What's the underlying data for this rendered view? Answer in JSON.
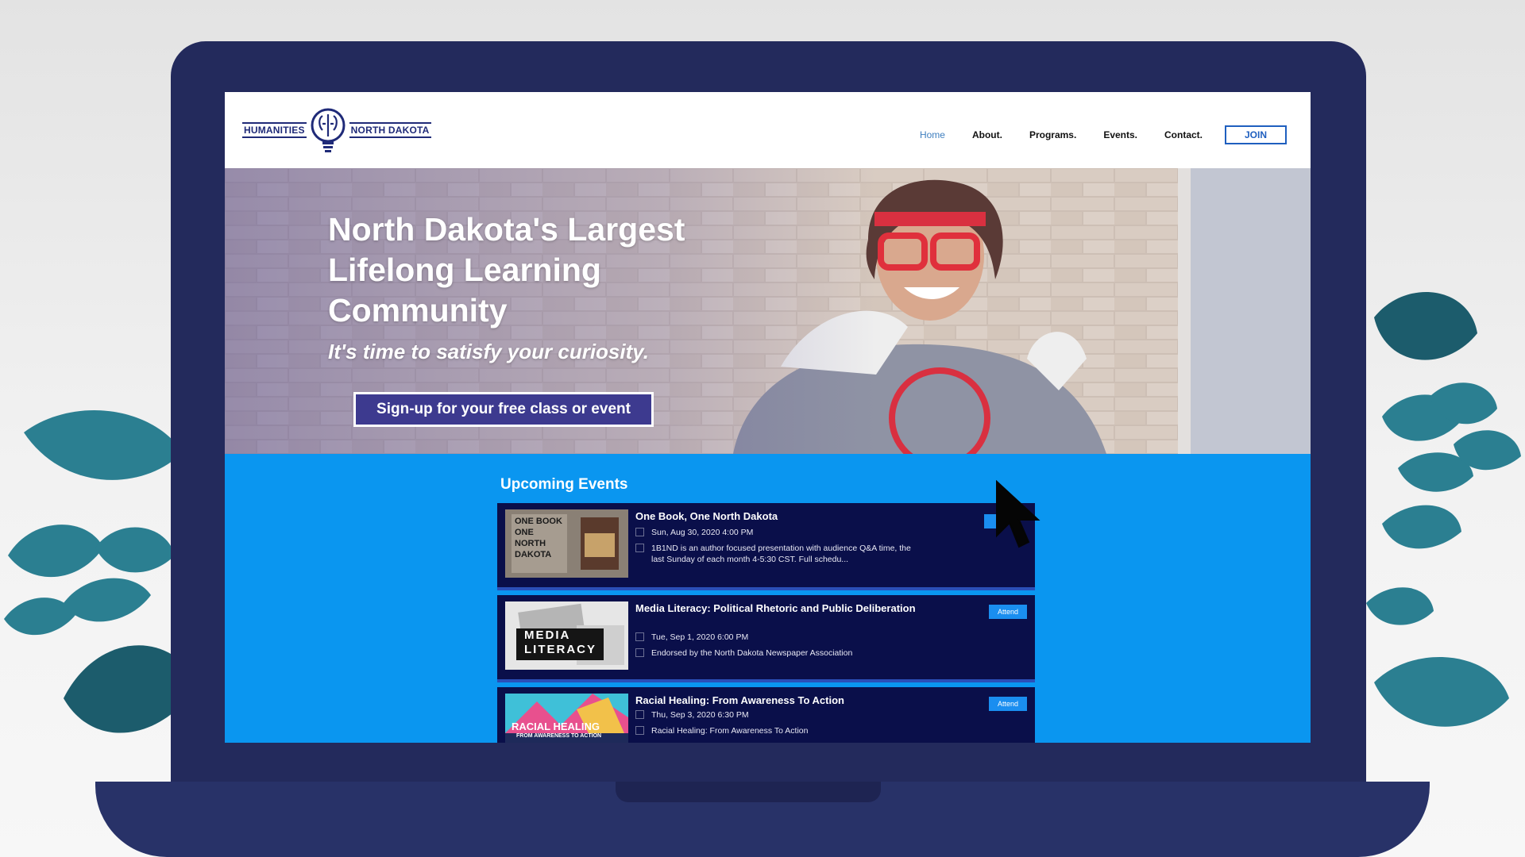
{
  "site": {
    "logo": {
      "left_text": "HUMANITIES",
      "right_text": "NORTH DAKOTA"
    },
    "nav": {
      "items": [
        "Home",
        "About.",
        "Programs.",
        "Events.",
        "Contact."
      ],
      "active": "Home",
      "join_label": "JOIN"
    }
  },
  "hero": {
    "title": "North Dakota's Largest Lifelong Learning Community",
    "subtitle": "It's time to satisfy your curiosity.",
    "cta_label": "Sign-up for your free class or event"
  },
  "events": {
    "heading": "Upcoming Events",
    "items": [
      {
        "title": "One Book, One North Dakota",
        "datetime": "Sun, Aug 30, 2020 4:00 PM",
        "description": "1B1ND is an author focused presentation with audience Q&A time, the last Sunday of each month 4-5:30 CST. Full schedu...",
        "thumb_text": "ONE BOOK ONE NORTH DAKOTA",
        "attend_label": ""
      },
      {
        "title": "Media Literacy: Political Rhetoric and Public Deliberation",
        "datetime": "Tue, Sep 1, 2020 6:00 PM",
        "description": "Endorsed by the North Dakota Newspaper Association",
        "thumb_text_1": "MEDIA",
        "thumb_text_2": "LITERACY",
        "attend_label": "Attend"
      },
      {
        "title": "Racial Healing: From Awareness To Action",
        "datetime": "Thu, Sep 3, 2020 6:30 PM",
        "description": "Racial Healing: From Awareness To Action",
        "thumb_text_1": "RACIAL HEALING",
        "thumb_text_2": "FROM AWARENESS TO ACTION",
        "attend_label": "Attend"
      }
    ]
  },
  "colors": {
    "laptop_frame": "#232a5c",
    "page_accent_blue": "#0a96f0",
    "event_card_bg": "#0a0f4a",
    "cta_purple": "#3d3a8f",
    "leaf_teal": "#1e6f80"
  }
}
